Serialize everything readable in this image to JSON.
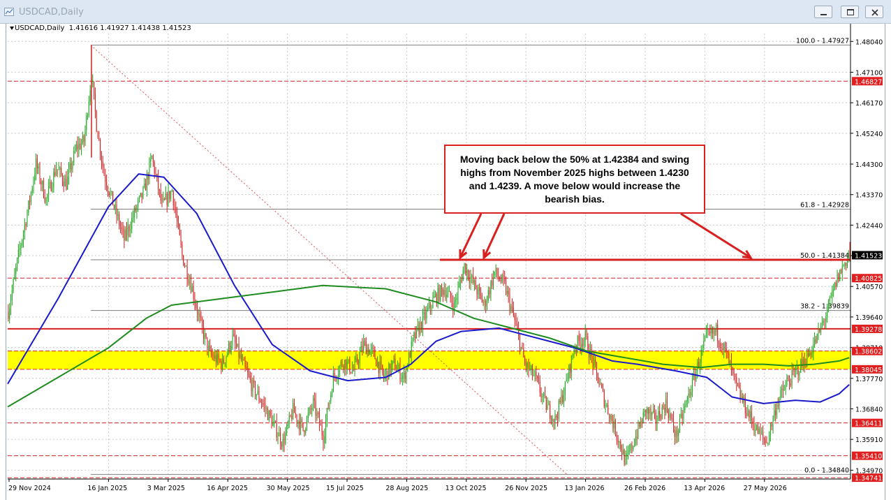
{
  "window": {
    "title": "USDCAD,Daily",
    "buttons": [
      "minimize",
      "restore",
      "close"
    ]
  },
  "symbol_line": "USDCAD,Daily  1.41616 1.41927 1.41438 1.41523",
  "annotation": "Moving back below the 50% at 1.42384 and swing highs from November 2025 highs between 1.4230 and 1.4239.  A move below would increase the bearish bias.",
  "colors": {
    "bull_candle": "#1aa31a",
    "bear_candle": "#d02020",
    "ma_fast": "#1a1acc",
    "ma_slow": "#1e8c1e",
    "zone": "#ffff00",
    "level_line": "#d8201f",
    "price_tag_bg": "#e02020"
  },
  "chart_data": {
    "type": "candlestick",
    "symbol": "USDCAD",
    "timeframe": "Daily",
    "ohlc_last": {
      "open": 1.41616,
      "high": 1.41927,
      "low": 1.41438,
      "close": 1.41523
    },
    "ylim": [
      1.347,
      1.4828
    ],
    "y_ticks": [
      "1.48040",
      "1.47100",
      "1.46170",
      "1.45240",
      "1.44300",
      "1.43370",
      "1.42440",
      "1.41510",
      "1.40570",
      "1.39640",
      "1.38710",
      "1.37770",
      "1.36840",
      "1.35910",
      "1.34970"
    ],
    "x_ticks": [
      "29 Nov 2024",
      "16 Jan 2025",
      "3 Mar 2025",
      "16 Apr 2025",
      "30 May 2025",
      "15 Jul 2025",
      "28 Aug 2025",
      "13 Oct 2025",
      "26 Nov 2025",
      "13 Jan 2026",
      "26 Feb 2026",
      "13 Apr 2026",
      "27 May 2026"
    ],
    "fibonacci": [
      {
        "label": "100.0 - 1.47927",
        "value": 1.47927
      },
      {
        "label": "61.8 - 1.42928",
        "value": 1.42928
      },
      {
        "label": "50.0 - 1.41384",
        "value": 1.41384
      },
      {
        "label": "38.2 - 1.39839",
        "value": 1.39839
      },
      {
        "label": "0.0 - 1.34840",
        "value": 1.3484
      }
    ],
    "horizontal_levels": [
      {
        "label": "1.46827",
        "value": 1.46827,
        "style": "dashed"
      },
      {
        "label": "1.40825",
        "value": 1.40825,
        "style": "dashed"
      },
      {
        "label": "1.39278",
        "value": 1.39278,
        "style": "solid"
      },
      {
        "label": "1.38602",
        "value": 1.38602,
        "style": "dashed"
      },
      {
        "label": "1.38045",
        "value": 1.38045,
        "style": "dashed"
      },
      {
        "label": "1.36411",
        "value": 1.36411,
        "style": "dashed"
      },
      {
        "label": "1.35410",
        "value": 1.3541,
        "style": "dashed"
      },
      {
        "label": "1.34741",
        "value": 1.34741,
        "style": "dashed"
      }
    ],
    "current_price": {
      "label": "1.41523",
      "value": 1.41523
    },
    "resistance_line": {
      "value": 1.41384
    },
    "support_zone": [
      1.38045,
      1.38602
    ],
    "price_path": [
      [
        0,
        1.398
      ],
      [
        8,
        1.415
      ],
      [
        16,
        1.43
      ],
      [
        22,
        1.443
      ],
      [
        30,
        1.432
      ],
      [
        38,
        1.442
      ],
      [
        46,
        1.437
      ],
      [
        54,
        1.448
      ],
      [
        60,
        1.45
      ],
      [
        66,
        1.47
      ],
      [
        70,
        1.455
      ],
      [
        76,
        1.44
      ],
      [
        84,
        1.43
      ],
      [
        92,
        1.42
      ],
      [
        100,
        1.428
      ],
      [
        108,
        1.435
      ],
      [
        114,
        1.445
      ],
      [
        122,
        1.43
      ],
      [
        130,
        1.435
      ],
      [
        138,
        1.415
      ],
      [
        146,
        1.405
      ],
      [
        152,
        1.395
      ],
      [
        160,
        1.385
      ],
      [
        170,
        1.382
      ],
      [
        178,
        1.39
      ],
      [
        186,
        1.382
      ],
      [
        194,
        1.375
      ],
      [
        202,
        1.37
      ],
      [
        210,
        1.364
      ],
      [
        218,
        1.358
      ],
      [
        226,
        1.368
      ],
      [
        234,
        1.362
      ],
      [
        242,
        1.37
      ],
      [
        250,
        1.36
      ],
      [
        258,
        1.378
      ],
      [
        266,
        1.383
      ],
      [
        274,
        1.38
      ],
      [
        282,
        1.388
      ],
      [
        290,
        1.385
      ],
      [
        298,
        1.378
      ],
      [
        306,
        1.382
      ],
      [
        314,
        1.378
      ],
      [
        322,
        1.39
      ],
      [
        330,
        1.396
      ],
      [
        338,
        1.402
      ],
      [
        346,
        1.405
      ],
      [
        354,
        1.4
      ],
      [
        362,
        1.412
      ],
      [
        370,
        1.406
      ],
      [
        378,
        1.4
      ],
      [
        386,
        1.41
      ],
      [
        394,
        1.406
      ],
      [
        402,
        1.395
      ],
      [
        410,
        1.382
      ],
      [
        418,
        1.378
      ],
      [
        426,
        1.37
      ],
      [
        434,
        1.365
      ],
      [
        442,
        1.375
      ],
      [
        450,
        1.388
      ],
      [
        458,
        1.39
      ],
      [
        466,
        1.38
      ],
      [
        474,
        1.37
      ],
      [
        482,
        1.362
      ],
      [
        490,
        1.352
      ],
      [
        498,
        1.36
      ],
      [
        506,
        1.368
      ],
      [
        514,
        1.365
      ],
      [
        522,
        1.37
      ],
      [
        530,
        1.36
      ],
      [
        538,
        1.37
      ],
      [
        546,
        1.38
      ],
      [
        554,
        1.39
      ],
      [
        562,
        1.392
      ],
      [
        570,
        1.385
      ],
      [
        578,
        1.375
      ],
      [
        586,
        1.368
      ],
      [
        594,
        1.362
      ],
      [
        602,
        1.358
      ],
      [
        610,
        1.37
      ],
      [
        618,
        1.376
      ],
      [
        626,
        1.38
      ],
      [
        634,
        1.384
      ],
      [
        642,
        1.39
      ],
      [
        650,
        1.398
      ],
      [
        658,
        1.408
      ],
      [
        664,
        1.413
      ],
      [
        668,
        1.4152
      ]
    ],
    "ma_fast": [
      [
        0,
        1.376
      ],
      [
        40,
        1.402
      ],
      [
        80,
        1.43
      ],
      [
        104,
        1.44
      ],
      [
        124,
        1.439
      ],
      [
        150,
        1.428
      ],
      [
        180,
        1.406
      ],
      [
        210,
        1.388
      ],
      [
        240,
        1.38
      ],
      [
        270,
        1.377
      ],
      [
        300,
        1.378
      ],
      [
        320,
        1.382
      ],
      [
        340,
        1.389
      ],
      [
        360,
        1.392
      ],
      [
        390,
        1.393
      ],
      [
        420,
        1.39
      ],
      [
        450,
        1.387
      ],
      [
        480,
        1.383
      ],
      [
        500,
        1.382
      ],
      [
        530,
        1.38
      ],
      [
        555,
        1.378
      ],
      [
        575,
        1.372
      ],
      [
        600,
        1.37
      ],
      [
        625,
        1.371
      ],
      [
        645,
        1.3705
      ],
      [
        660,
        1.373
      ],
      [
        668,
        1.3758
      ]
    ],
    "ma_slow": [
      [
        0,
        1.369
      ],
      [
        40,
        1.378
      ],
      [
        80,
        1.387
      ],
      [
        110,
        1.396
      ],
      [
        130,
        1.4
      ],
      [
        170,
        1.402
      ],
      [
        210,
        1.404
      ],
      [
        250,
        1.406
      ],
      [
        300,
        1.405
      ],
      [
        340,
        1.401
      ],
      [
        370,
        1.396
      ],
      [
        400,
        1.393
      ],
      [
        430,
        1.39
      ],
      [
        460,
        1.386
      ],
      [
        490,
        1.384
      ],
      [
        520,
        1.382
      ],
      [
        550,
        1.381
      ],
      [
        575,
        1.382
      ],
      [
        600,
        1.382
      ],
      [
        620,
        1.3815
      ],
      [
        640,
        1.382
      ],
      [
        660,
        1.383
      ],
      [
        668,
        1.384
      ]
    ]
  }
}
